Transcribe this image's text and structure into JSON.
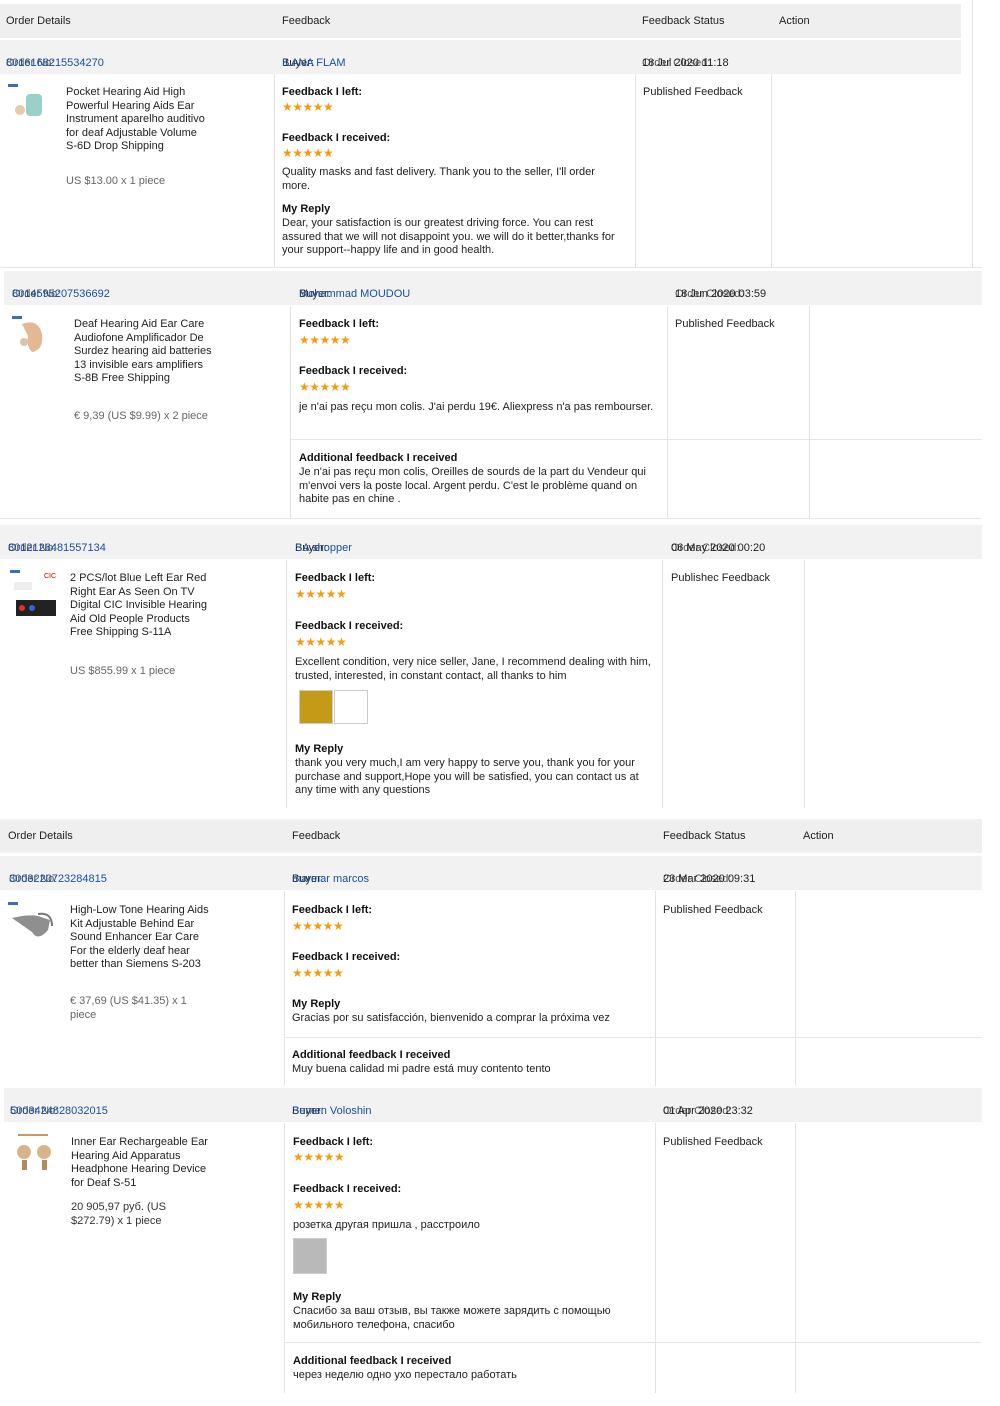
{
  "header": {
    "order_details": "Order Details",
    "feedback": "Feedback",
    "feedback_status": "Feedback Status",
    "action": "Action"
  },
  "labels": {
    "order_no": "Order No:",
    "buyer": "Buyer:",
    "order_closed": "Order Closed:",
    "feedback_left": "Feedback I left:",
    "feedback_received": "Feedback I received:",
    "my_reply": "My Reply",
    "additional": "Additional feedback I received"
  },
  "stars": "★★★★★",
  "orders": [
    {
      "order_no": "8016168215534270",
      "buyer": "ILANA FLAM",
      "closed": "18 Jul 2020 11:18",
      "product": "Pocket Hearing Aid High Powerful Hearing Aids Ear Instrument aparelho auditivo for deaf Adjustable Volume S-6D Drop Shipping",
      "price": "US $13.00 x 1 piece",
      "received_text": "Quality masks and fast delivery. Thank you to the seller, I'll order more.",
      "reply": "Dear, your satisfaction is our greatest driving force. You can rest assured that we will not disappoint you. we will do it better,thanks for your support--happy life and in good health.",
      "status": "Published Feedback"
    },
    {
      "order_no": "8014595207536692",
      "buyer": "Mohammad MOUDOU",
      "closed": "18 Jun 2020 03:59",
      "product": "Deaf Hearing Aid Ear Care Audiofone Amplificador De Surdez hearing aid batteries 13 invisible ears amplifiers S-8B Free Shipping",
      "price": "€ 9,39 (US $9.99) x 2 piece",
      "received_text": "je n'ai pas reçu mon colis. J'ai perdu 19€. Aliexpress n'a pas rembourser.",
      "additional": "Je n'ai pas reçu mon colis, Oreilles de sourds de la part du Vendeur qui m'envoi vers la poste local. Argent perdu. C'est le problème quand on habite pas en chine .",
      "status": "Published Feedback"
    },
    {
      "order_no": "8012126481557134",
      "buyer": "SA shopper",
      "closed": "06 May 2020 00:20",
      "product": "2 PCS/lot Blue Left Ear Red Right Ear As Seen On TV Digital CIC Invisible Hearing Aid Old People Products Free Shipping S-11A",
      "price": "US $855.99 x 1 piece",
      "received_text": "Excellent condition, very nice seller, Jane, I recommend dealing with him, trusted, interested, in constant contact, all thanks to him",
      "reply": "thank you very much,I am very happy to serve you, thank you for your purchase and support,Hope you will be satisfied, you can contact us at any time with any questions",
      "status": "Publishec Feedback"
    },
    {
      "order_no": "3003220723284815",
      "buyer": "marmar marcos",
      "closed": "23 Mar 2020 09:31",
      "product": "High-Low Tone Hearing Aids Kit Adjustable Behind Ear Sound Enhancer Ear Care For the elderly deaf hear better than Siemens S-203",
      "price": "€ 37,69 (US $41.35) x 1 piece",
      "reply": "Gracias por su satisfacción, bienvenido a comprar la próxima vez",
      "additional": "Muy buena calidad mi padre está muy contento tento",
      "status": "Published Feedback"
    },
    {
      "order_no": "5003424828032015",
      "buyer": "Semen Voloshin",
      "closed": "01 Apr 2020 23:32",
      "product": "Inner Ear Rechargeable Ear Hearing Aid Apparatus Headphone Hearing Device for Deaf S-51",
      "price": "20 905,97 руб. (US $272.79) x 1 piece",
      "received_text": "розетка другая пришла , расстроило",
      "reply": "Спасибо за ваш отзыв, вы также можете зарядить с помощью мобильного телефона, спасибо",
      "additional": "через неделю одно ухо перестало работать",
      "status": "Published Feedback"
    }
  ]
}
